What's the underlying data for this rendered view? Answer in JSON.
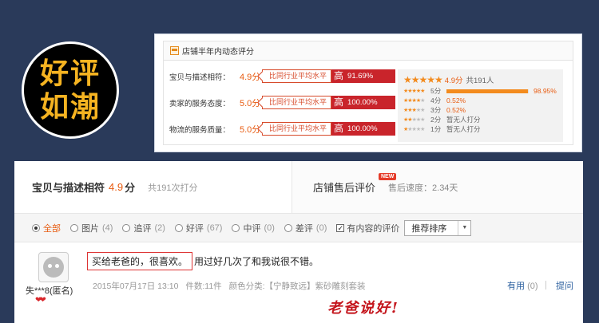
{
  "badge": {
    "line1": "好评",
    "line2": "如潮"
  },
  "rating_card": {
    "title": "店铺半年内动态评分",
    "rows": [
      {
        "label": "宝贝与描述相符：",
        "score": "4.9分",
        "compare": "比同行业平均水平",
        "level": "高",
        "pct": "91.69%"
      },
      {
        "label": "卖家的服务态度：",
        "score": "5.0分",
        "compare": "比同行业平均水平",
        "level": "高",
        "pct": "100.00%"
      },
      {
        "label": "物流的服务质量：",
        "score": "5.0分",
        "compare": "比同行业平均水平",
        "level": "高",
        "pct": "100.00%"
      }
    ],
    "distribution": {
      "summary_score": "4.9分",
      "summary_count": "共191人",
      "rows": [
        {
          "label": "5分",
          "value": "98.95%",
          "fraction": 0.9895,
          "has_bar": true
        },
        {
          "label": "4分",
          "value": "0.52%",
          "has_bar": false
        },
        {
          "label": "3分",
          "value": "0.52%",
          "has_bar": false
        },
        {
          "label": "2分",
          "value": "暂无人打分",
          "has_bar": false
        },
        {
          "label": "1分",
          "value": "暂无人打分",
          "has_bar": false
        }
      ]
    }
  },
  "reviews": {
    "header": {
      "title": "宝贝与描述相符",
      "score": "4.9",
      "unit": "分",
      "count": "共191次打分",
      "after_sale_title": "店铺售后评价",
      "new_badge": "NEW",
      "speed": "售后速度：2.34天"
    },
    "filters": [
      {
        "label": "全部",
        "count": "",
        "selected": true
      },
      {
        "label": "图片",
        "count": "(4)",
        "selected": false
      },
      {
        "label": "追评",
        "count": "(2)",
        "selected": false
      },
      {
        "label": "好评",
        "count": "(67)",
        "selected": false
      },
      {
        "label": "中评",
        "count": "(0)",
        "selected": false
      },
      {
        "label": "差评",
        "count": "(0)",
        "selected": false
      }
    ],
    "content_filter_label": "有内容的评价",
    "sort": {
      "value": "推荐排序"
    },
    "item": {
      "user": "失***8(匿名)",
      "highlight": "买给老爸的，很喜欢。",
      "text": "用过好几次了和我说很不错。",
      "date": "2015年07月17日 13:10",
      "pieces": "件数:11件",
      "color": "颜色分类:【宁静致远】紫砂雕刻套装",
      "useful": "有用",
      "useful_count": "(0)",
      "ask": "提问",
      "note": "老爸说好!"
    }
  }
}
